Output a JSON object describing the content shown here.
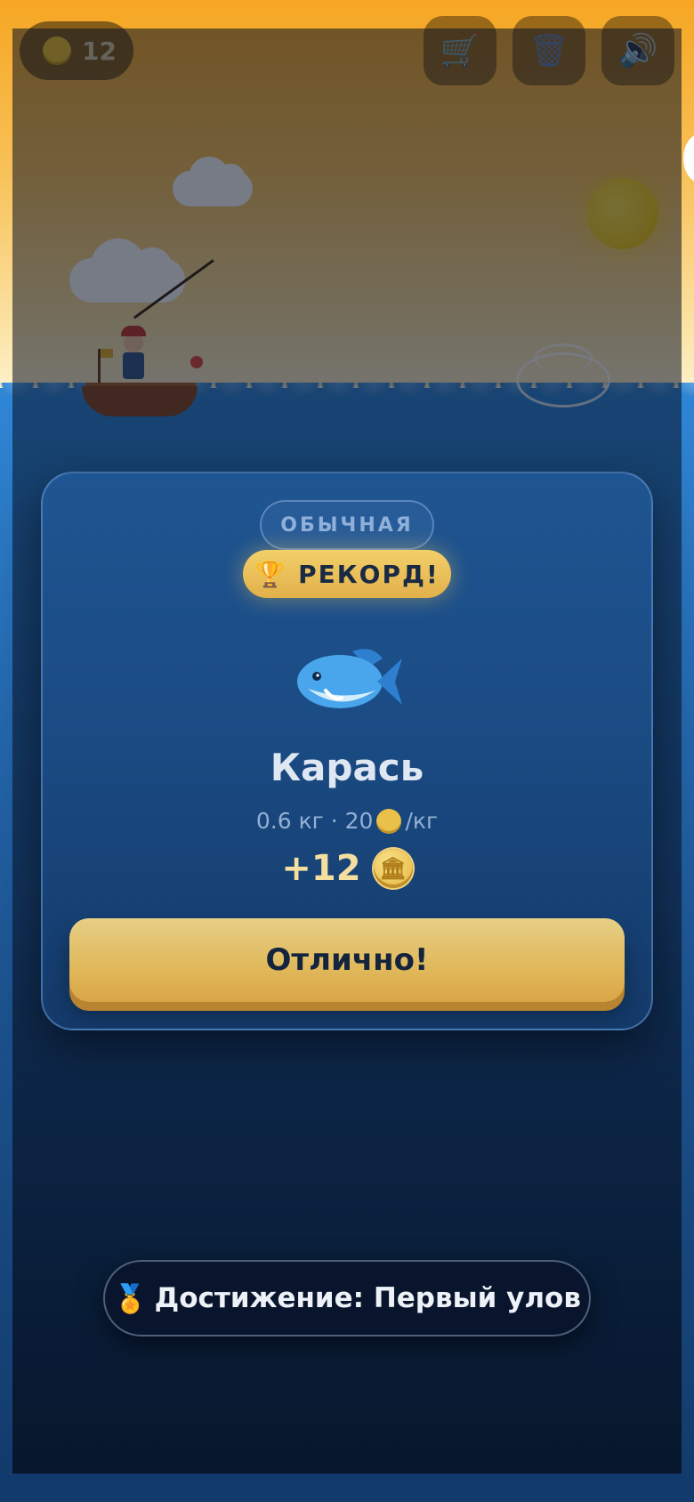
{
  "hud": {
    "coins": "12",
    "coin_icon": "coin-icon",
    "buttons": [
      {
        "name": "shop",
        "icon": "🛒"
      },
      {
        "name": "trash",
        "icon": "🗑"
      },
      {
        "name": "sound",
        "icon": "🔊"
      }
    ]
  },
  "catch_card": {
    "rarity": "ОБЫЧНАЯ",
    "record_icon": "🏆",
    "record_label": "РЕКОРД!",
    "fish_name": "Карась",
    "weight": "0.6 кг · 20",
    "price_unit": "/кг",
    "reward": "+12",
    "reward_coin_glyph": "🏛",
    "confirm_label": "Отлично!"
  },
  "toast": {
    "icon": "🏅",
    "text": "Достижение: Первый улов"
  },
  "colors": {
    "sky_top": "#f6a623",
    "sea": "#1b4f8a",
    "gold": "#e2b04a",
    "card": "#1a4a82"
  }
}
